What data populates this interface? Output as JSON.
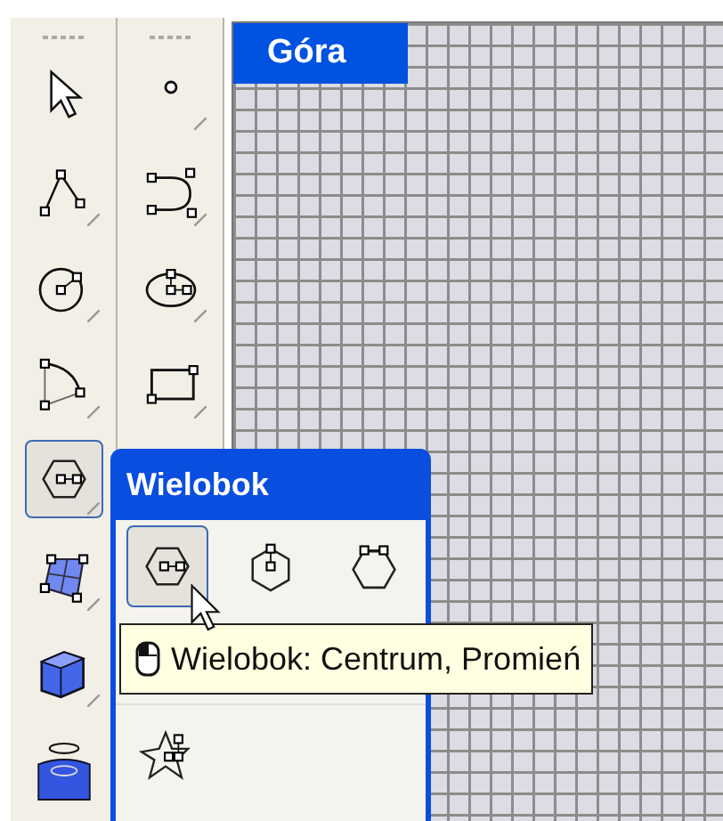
{
  "toolbar": {
    "columns": [
      {
        "tools": [
          {
            "kind": "arrow",
            "selected": false,
            "flyout": false
          },
          {
            "kind": "polyline",
            "selected": false,
            "flyout": true
          },
          {
            "kind": "circle",
            "selected": false,
            "flyout": true
          },
          {
            "kind": "arc",
            "selected": false,
            "flyout": true
          },
          {
            "kind": "polygon",
            "selected": true,
            "flyout": true
          },
          {
            "kind": "surface",
            "selected": false,
            "flyout": true
          },
          {
            "kind": "box",
            "selected": false,
            "flyout": true
          },
          {
            "kind": "cylinder",
            "selected": false,
            "flyout": false
          }
        ]
      },
      {
        "tools": [
          {
            "kind": "point",
            "selected": false,
            "flyout": true
          },
          {
            "kind": "curve",
            "selected": false,
            "flyout": true
          },
          {
            "kind": "ellipse",
            "selected": false,
            "flyout": true
          },
          {
            "kind": "rectangle",
            "selected": false,
            "flyout": true
          }
        ]
      }
    ]
  },
  "viewport": {
    "label": "Góra"
  },
  "flyout": {
    "title": "Wielobok",
    "tools": [
      {
        "kind": "polygon",
        "selected": true
      },
      {
        "kind": "polygon-edge",
        "selected": false
      },
      {
        "kind": "polygon-side",
        "selected": false
      }
    ],
    "tooltip": "Wielobok: Centrum, Promień",
    "more_tools": [
      {
        "kind": "star",
        "selected": false
      }
    ]
  }
}
